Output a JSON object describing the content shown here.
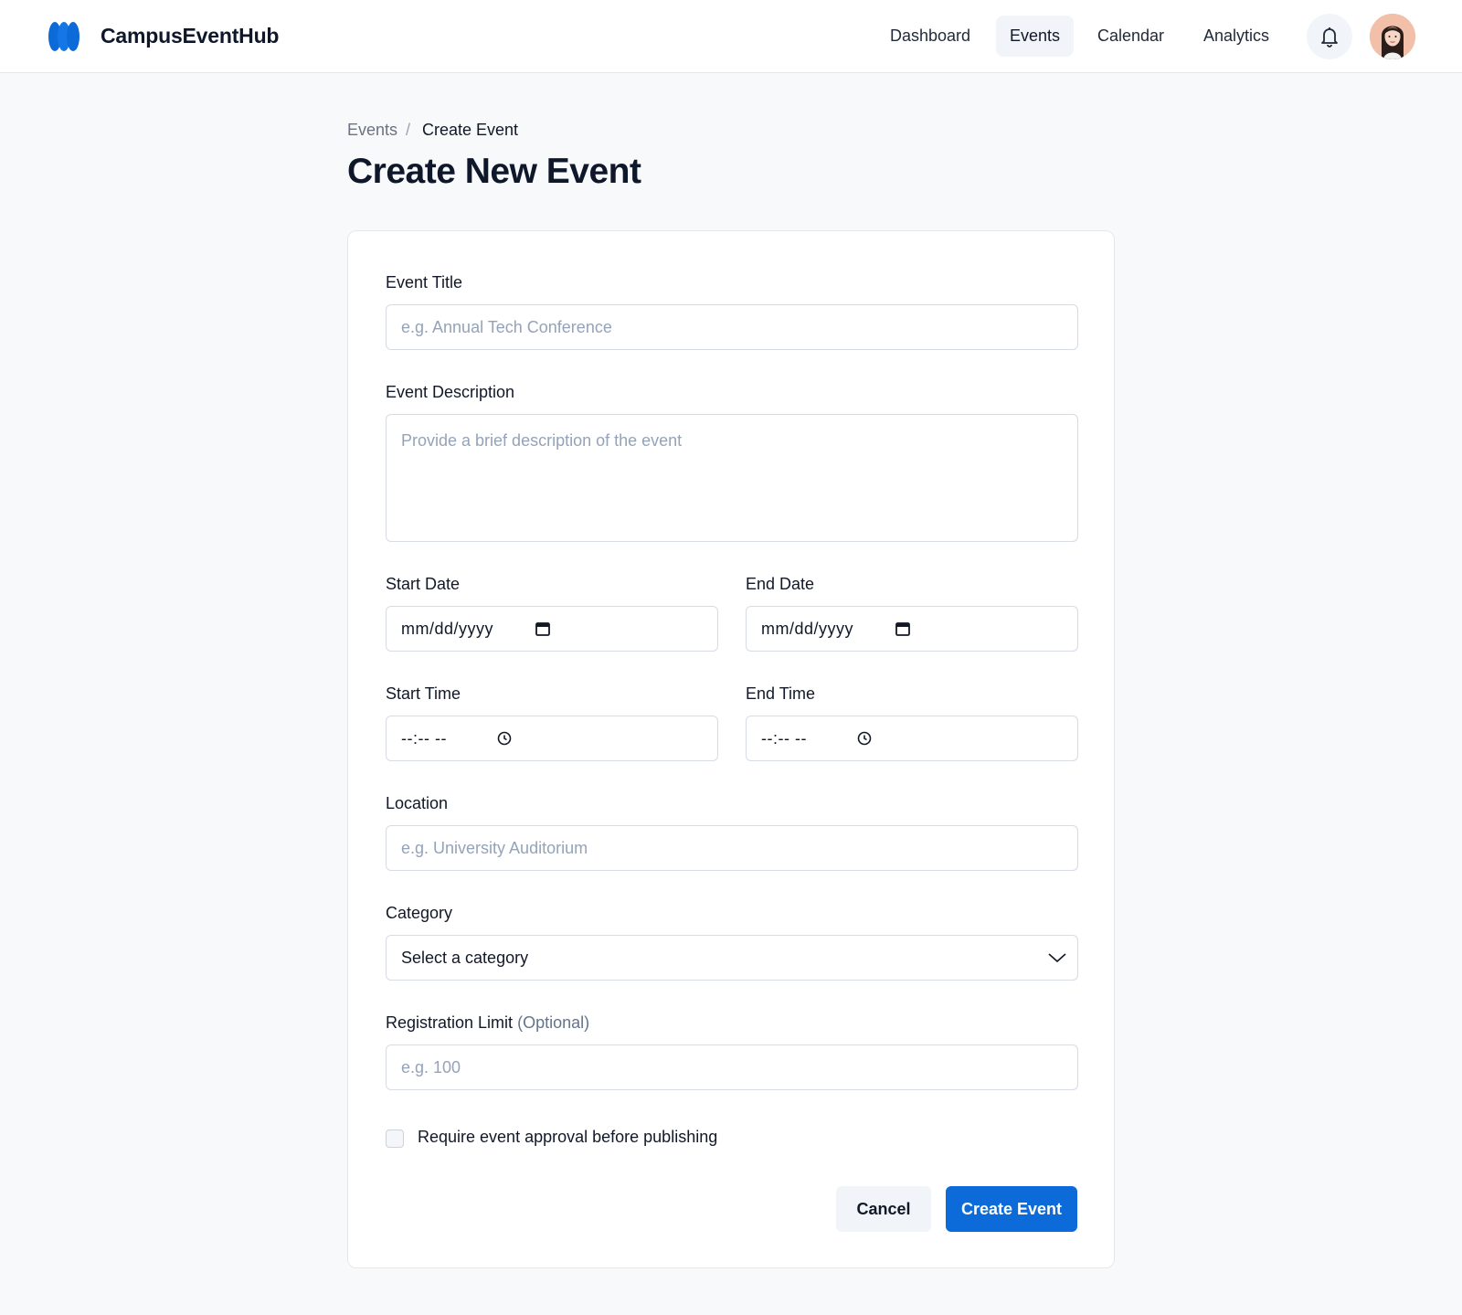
{
  "app": {
    "name": "CampusEventHub"
  },
  "nav": {
    "items": [
      {
        "label": "Dashboard"
      },
      {
        "label": "Events",
        "active": true
      },
      {
        "label": "Calendar"
      },
      {
        "label": "Analytics"
      }
    ],
    "bell_icon": "bell-icon",
    "avatar_icon": "user-avatar"
  },
  "breadcrumb": {
    "parent": "Events",
    "separator": "/",
    "current": "Create Event"
  },
  "page": {
    "title": "Create New Event"
  },
  "form": {
    "title": {
      "label": "Event Title",
      "placeholder": "e.g. Annual Tech Conference",
      "value": ""
    },
    "description": {
      "label": "Event Description",
      "placeholder": "Provide a brief description of the event",
      "value": ""
    },
    "start_date": {
      "label": "Start Date",
      "display": "mm/dd/yyyy"
    },
    "end_date": {
      "label": "End Date",
      "display": "mm/dd/yyyy"
    },
    "start_time": {
      "label": "Start Time",
      "display": "--:-- --"
    },
    "end_time": {
      "label": "End Time",
      "display": "--:-- --"
    },
    "location": {
      "label": "Location",
      "placeholder": "e.g. University Auditorium",
      "value": ""
    },
    "category": {
      "label": "Category",
      "selected": "Select a category"
    },
    "registration_limit": {
      "label": "Registration Limit",
      "optional": "(Optional)",
      "placeholder": "e.g. 100",
      "value": ""
    },
    "approval": {
      "label": "Require event approval before publishing",
      "checked": false
    }
  },
  "actions": {
    "cancel": "Cancel",
    "create": "Create Event"
  },
  "colors": {
    "accent": "#0c6bd8",
    "background": "#f7f9fb",
    "border": "#d6dbe4"
  }
}
